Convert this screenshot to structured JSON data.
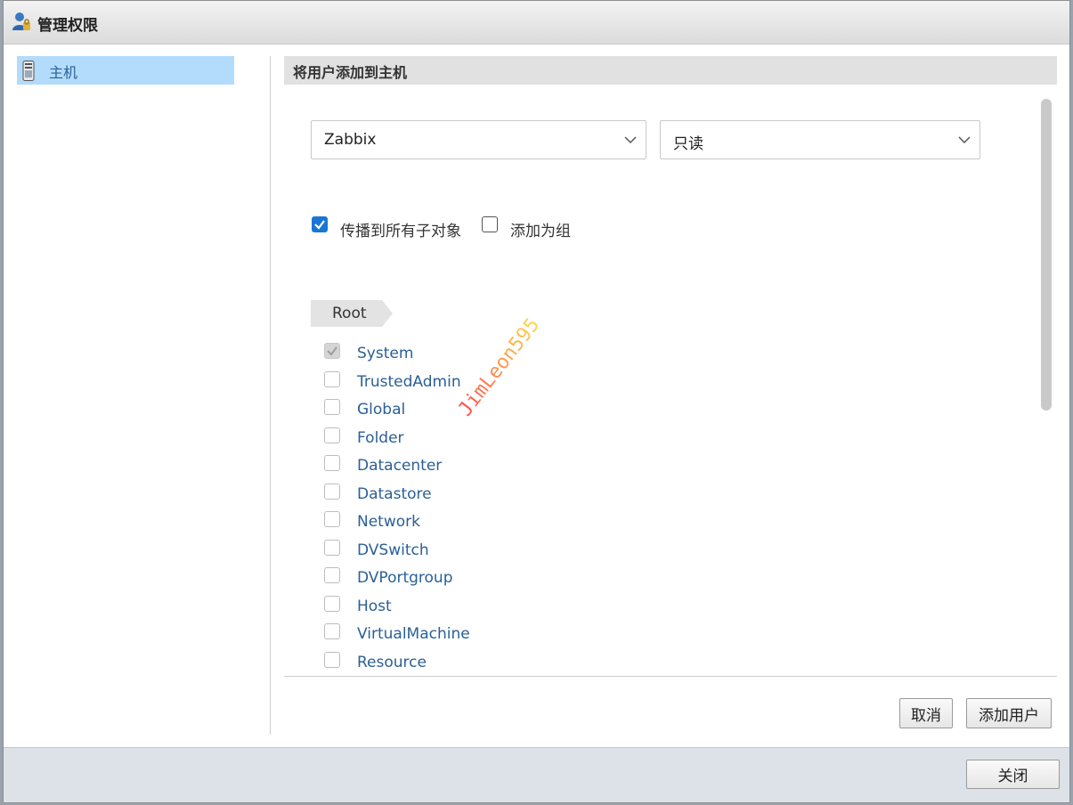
{
  "window": {
    "title": "管理权限"
  },
  "sidebar": {
    "items": [
      {
        "label": "主机",
        "selected": true
      }
    ]
  },
  "section": {
    "title": "将用户添加到主机"
  },
  "form": {
    "user_select": {
      "value": "Zabbix"
    },
    "role_select": {
      "value": "只读"
    },
    "propagate": {
      "label": "传播到所有子对象",
      "checked": true
    },
    "add_as_group": {
      "label": "添加为组",
      "checked": false
    }
  },
  "breadcrumb": {
    "root": "Root"
  },
  "privileges": [
    {
      "label": "System",
      "checked": true,
      "disabled": true
    },
    {
      "label": "TrustedAdmin",
      "checked": false,
      "disabled": true
    },
    {
      "label": "Global",
      "checked": false,
      "disabled": true
    },
    {
      "label": "Folder",
      "checked": false,
      "disabled": true
    },
    {
      "label": "Datacenter",
      "checked": false,
      "disabled": true
    },
    {
      "label": "Datastore",
      "checked": false,
      "disabled": true
    },
    {
      "label": "Network",
      "checked": false,
      "disabled": true
    },
    {
      "label": "DVSwitch",
      "checked": false,
      "disabled": true
    },
    {
      "label": "DVPortgroup",
      "checked": false,
      "disabled": true
    },
    {
      "label": "Host",
      "checked": false,
      "disabled": true
    },
    {
      "label": "VirtualMachine",
      "checked": false,
      "disabled": true
    },
    {
      "label": "Resource",
      "checked": false,
      "disabled": true
    }
  ],
  "buttons": {
    "cancel": "取消",
    "add_user": "添加用户",
    "close": "关闭"
  },
  "watermark": {
    "text": "JimLeon595"
  },
  "colors": {
    "accent": "#1976d2",
    "selected_bg": "#b3dbfb",
    "link": "#2b5f96"
  },
  "icons": {
    "title": "user-permissions-icon",
    "sidebar": "host-device-icon",
    "select": "chevron-down-icon"
  }
}
